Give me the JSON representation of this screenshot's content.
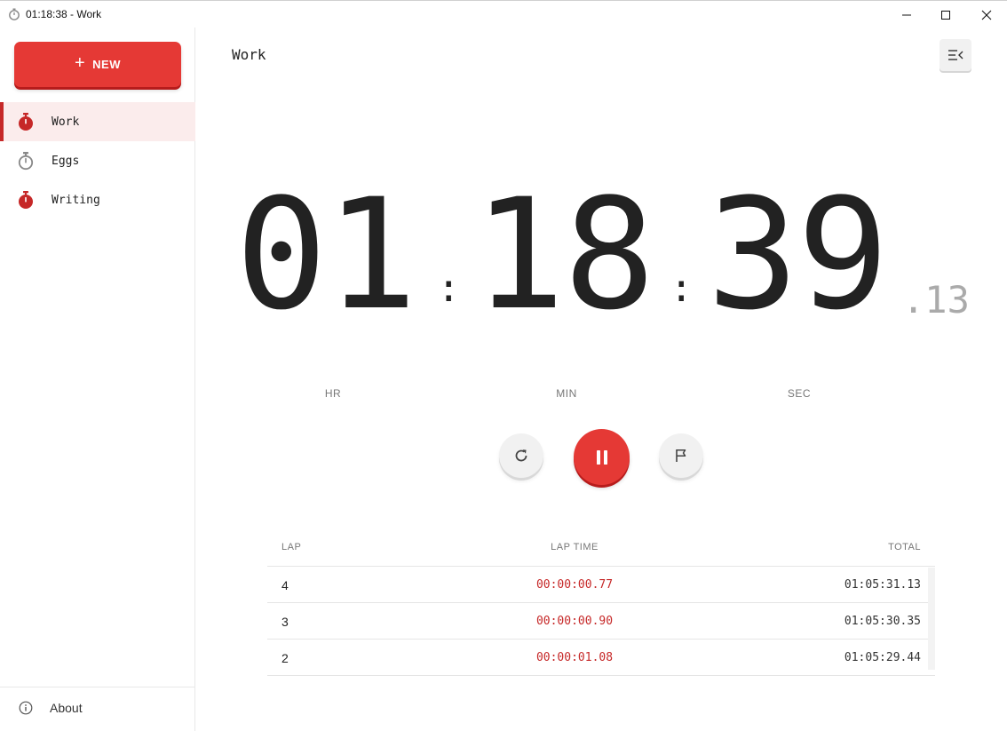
{
  "window": {
    "title": "01:18:38 - Work",
    "minimize_icon": "minimize-icon",
    "maximize_icon": "maximize-icon",
    "close_icon": "close-icon"
  },
  "sidebar": {
    "new_button": {
      "icon": "plus-icon",
      "label": "NEW"
    },
    "items": [
      {
        "label": "Work",
        "icon": "stopwatch-icon",
        "active": true,
        "color": "#c62828"
      },
      {
        "label": "Eggs",
        "icon": "stopwatch-icon",
        "active": false,
        "color": "#888888"
      },
      {
        "label": "Writing",
        "icon": "stopwatch-icon",
        "active": false,
        "color": "#c62828"
      }
    ],
    "about": {
      "icon": "info-icon",
      "label": "About"
    }
  },
  "main": {
    "title": "Work",
    "menu_icon": "collapse-menu-icon",
    "timer": {
      "hours": "01",
      "minutes": "18",
      "seconds": "39",
      "hundredths": ".13",
      "separator": ":",
      "units": {
        "hr": "HR",
        "min": "MIN",
        "sec": "SEC"
      }
    },
    "controls": {
      "reset_icon": "reset-icon",
      "pause_icon": "pause-icon",
      "lap_icon": "flag-icon"
    },
    "laps": {
      "headers": {
        "lap": "LAP",
        "lap_time": "LAP TIME",
        "total": "TOTAL"
      },
      "rows": [
        {
          "lap": "4",
          "lap_time": "00:00:00.77",
          "total": "01:05:31.13"
        },
        {
          "lap": "3",
          "lap_time": "00:00:00.90",
          "total": "01:05:30.35"
        },
        {
          "lap": "2",
          "lap_time": "00:00:01.08",
          "total": "01:05:29.44"
        }
      ]
    }
  },
  "colors": {
    "accent": "#e53935",
    "accent_dark": "#c62828",
    "active_bg": "#fbecec"
  }
}
